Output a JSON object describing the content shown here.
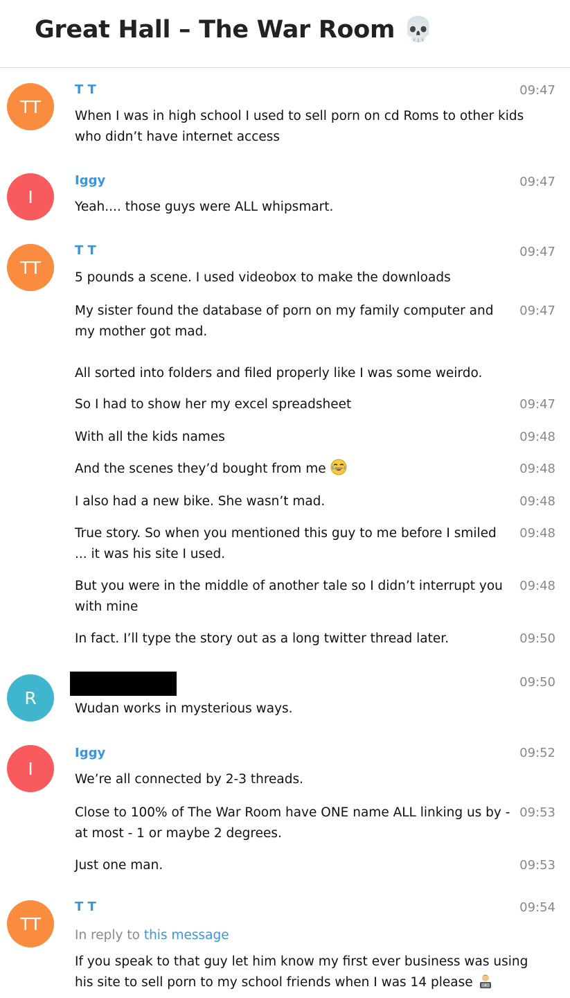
{
  "header": {
    "title": "Great Hall – The War Room 💀"
  },
  "colors": {
    "avatar_orange": "#f98c3f",
    "avatar_red": "#f85a5d",
    "avatar_teal": "#40b6ce",
    "name_blue": "#3a95dc",
    "time_gray": "#888888"
  },
  "messages": [
    {
      "avatar_initials": "TT",
      "author": "T T",
      "time": "09:47",
      "text": "When I was in high school I used to sell porn on cd Roms to other kids who didn’t have internet access"
    },
    {
      "avatar_initials": "I",
      "author": "Iggy",
      "time": "09:47",
      "text": "Yeah.... those guys were ALL whipsmart."
    },
    {
      "avatar_initials": "TT",
      "author": "T T",
      "time": "09:47",
      "text": "5 pounds a scene. I used videobox to make the downloads"
    },
    {
      "time": "09:47",
      "text": "My sister found the database of porn on my family computer and my mother got mad."
    },
    {
      "time": "",
      "text": "All sorted into folders and filed properly like I was some weirdo."
    },
    {
      "time": "09:47",
      "text": "So I had to show her my excel spreadsheet"
    },
    {
      "time": "09:48",
      "text": "With all the kids names"
    },
    {
      "time": "09:48",
      "text": "And the scenes they’d bought from me"
    },
    {
      "time": "09:48",
      "text": "I also had a new bike. She wasn’t mad."
    },
    {
      "time": "09:48",
      "text": "True story. So when you mentioned this guy to me before I smiled ... it was his site I used."
    },
    {
      "time": "09:48",
      "text": "But you were in the middle of another tale so I didn’t interrupt you with mine"
    },
    {
      "time": "09:50",
      "text": "In fact. I’ll type the story out as a long twitter thread later."
    },
    {
      "avatar_initials": "R",
      "author": "",
      "time": "09:50",
      "text": "Wudan works in mysterious ways."
    },
    {
      "avatar_initials": "I",
      "author": "Iggy",
      "time": "09:52",
      "text": "We’re all connected by 2-3 threads."
    },
    {
      "time": "09:53",
      "text": "Close to 100% of The War Room have ONE name ALL linking us by - at most - 1 or maybe 2 degrees."
    },
    {
      "time": "09:53",
      "text": "Just one man."
    },
    {
      "avatar_initials": "TT",
      "author": "T T",
      "time": "09:54",
      "reply_prefix": "In reply to",
      "reply_link": "this message",
      "text": "If you speak to that guy let him know my first ever business was using his site to sell porn to my school friends when I was 14 please"
    }
  ],
  "emoji_icons": [
    "laughing-face-icon",
    "man-technologist-icon"
  ]
}
